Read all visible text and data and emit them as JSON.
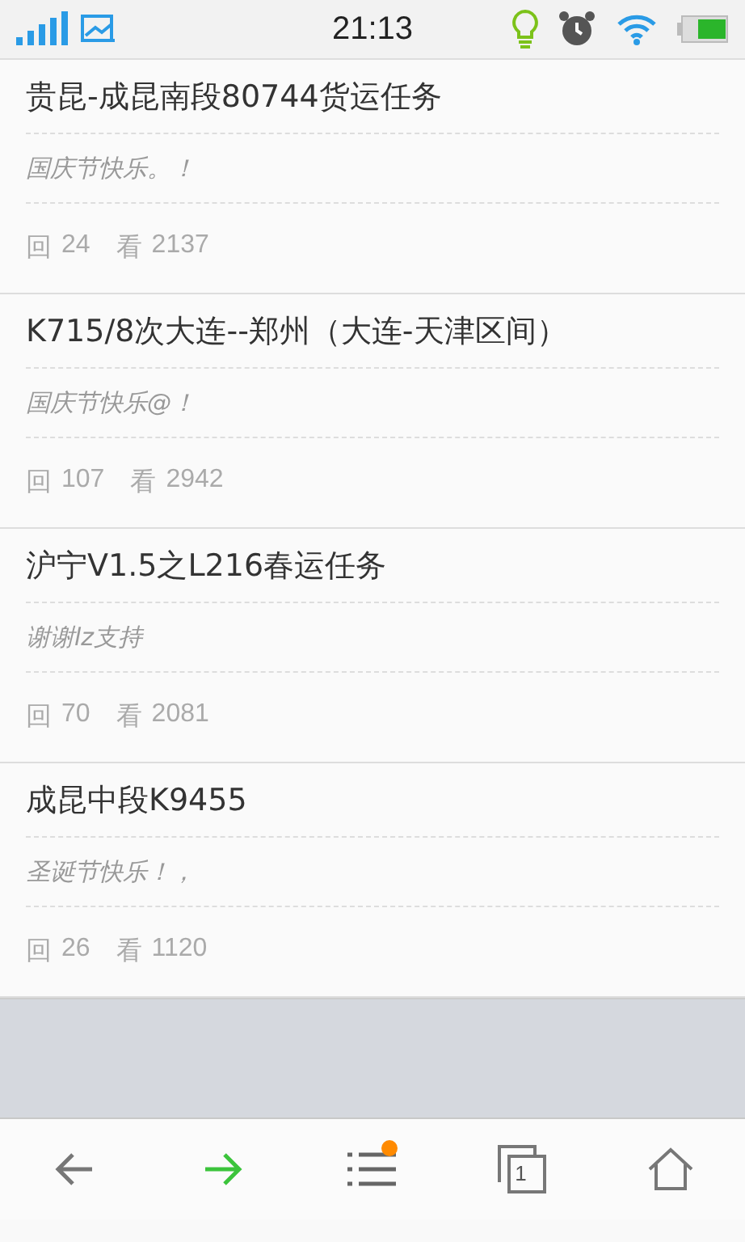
{
  "status_bar": {
    "time": "21:13"
  },
  "posts": [
    {
      "title": "贵昆-成昆南段80744货运任务",
      "excerpt": "国庆节快乐。！",
      "replies_label": "回",
      "replies": "24",
      "views_label": "看",
      "views": "2137"
    },
    {
      "title": "K715/8次大连--郑州（大连-天津区间）",
      "excerpt": "国庆节快乐@！",
      "replies_label": "回",
      "replies": "107",
      "views_label": "看",
      "views": "2942"
    },
    {
      "title": "沪宁V1.5之L216春运任务",
      "excerpt": "谢谢lz支持",
      "replies_label": "回",
      "replies": "70",
      "views_label": "看",
      "views": "2081"
    },
    {
      "title": "成昆中段K9455",
      "excerpt": "圣诞节快乐！，",
      "replies_label": "回",
      "replies": "26",
      "views_label": "看",
      "views": "1120"
    }
  ],
  "toolbar": {
    "menu_badge": true,
    "tab_count": "1"
  }
}
